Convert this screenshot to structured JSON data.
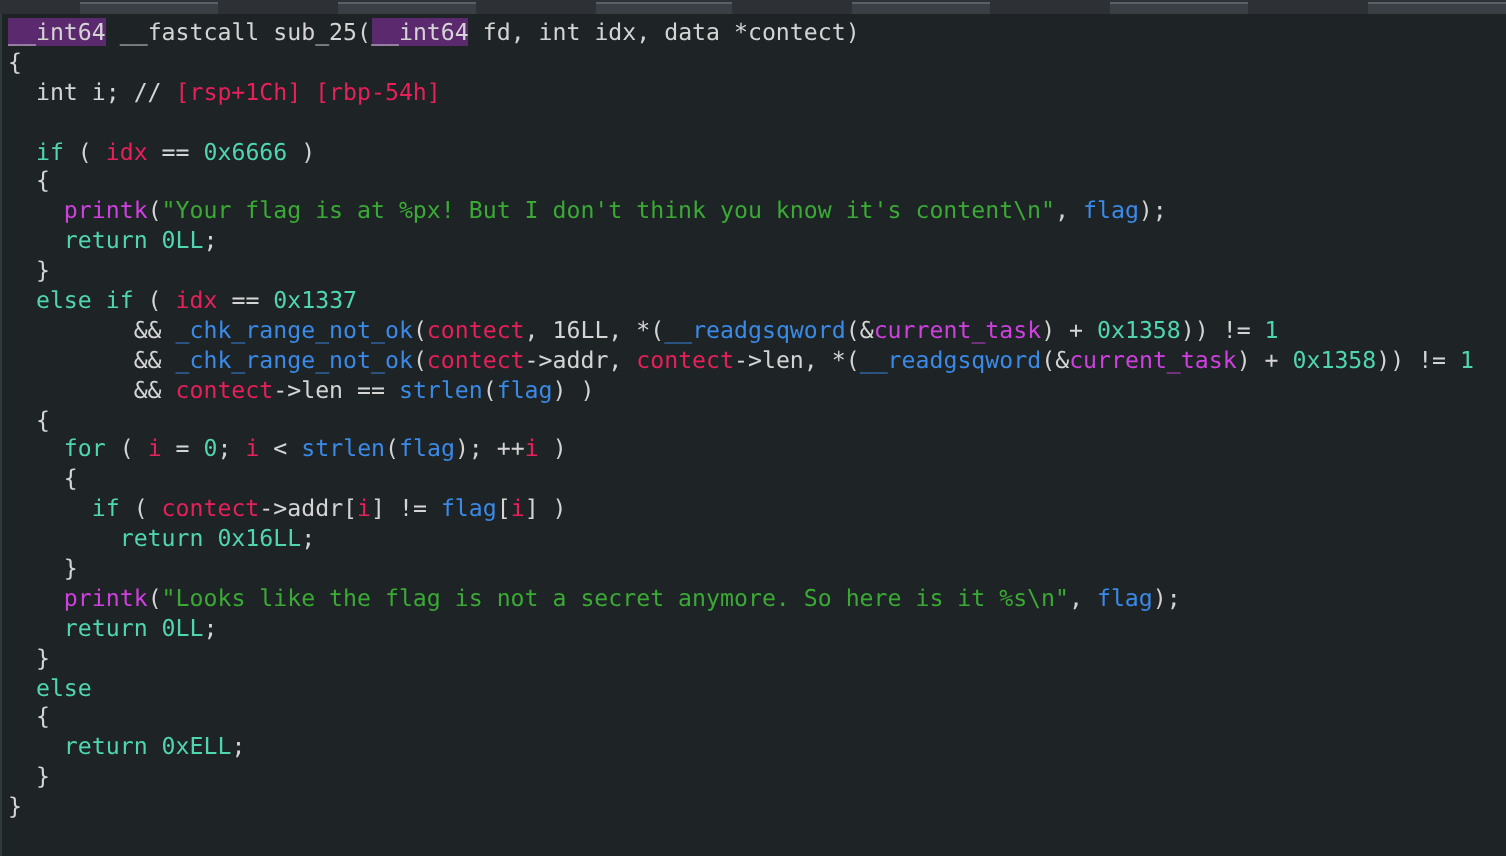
{
  "code_lines": [
    {
      "kind": "code",
      "tokens": [
        {
          "kind": "type",
          "text": "__int64"
        },
        {
          "kind": "plain",
          "text": " __fastcall sub_25("
        },
        {
          "kind": "type",
          "text": "__int64"
        },
        {
          "kind": "plain",
          "text": " fd, int idx, data *contect)"
        }
      ]
    },
    {
      "kind": "code",
      "tokens": [
        {
          "kind": "plain",
          "text": "{"
        }
      ]
    },
    {
      "kind": "code",
      "tokens": [
        {
          "kind": "plain",
          "text": "  int i; // "
        },
        {
          "kind": "address",
          "text": "[rsp+1Ch] [rbp-54h]"
        }
      ]
    },
    {
      "kind": "blank"
    },
    {
      "kind": "code",
      "tokens": [
        {
          "kind": "keyword",
          "text": "  if"
        },
        {
          "kind": "plain",
          "text": " ( "
        },
        {
          "kind": "var",
          "text": "idx"
        },
        {
          "kind": "plain",
          "text": " == "
        },
        {
          "kind": "number",
          "text": "0x6666"
        },
        {
          "kind": "plain",
          "text": " )"
        }
      ]
    },
    {
      "kind": "code",
      "tokens": [
        {
          "kind": "plain",
          "text": "  {"
        }
      ]
    },
    {
      "kind": "code",
      "tokens": [
        {
          "kind": "func",
          "text": "    printk"
        },
        {
          "kind": "plain",
          "text": "("
        },
        {
          "kind": "string",
          "text": "\"Your flag is at %px! But I don't think you know it's content\\n\""
        },
        {
          "kind": "plain",
          "text": ", "
        },
        {
          "kind": "call",
          "text": "flag"
        },
        {
          "kind": "plain",
          "text": ");"
        }
      ]
    },
    {
      "kind": "code",
      "tokens": [
        {
          "kind": "keyword",
          "text": "    return "
        },
        {
          "kind": "number",
          "text": "0LL"
        },
        {
          "kind": "plain",
          "text": ";"
        }
      ]
    },
    {
      "kind": "code",
      "tokens": [
        {
          "kind": "plain",
          "text": "  }"
        }
      ]
    },
    {
      "kind": "code",
      "tokens": [
        {
          "kind": "keyword",
          "text": "  else if"
        },
        {
          "kind": "plain",
          "text": " ( "
        },
        {
          "kind": "var",
          "text": "idx"
        },
        {
          "kind": "plain",
          "text": " == "
        },
        {
          "kind": "number",
          "text": "0x1337"
        }
      ]
    },
    {
      "kind": "code",
      "tokens": [
        {
          "kind": "plain",
          "text": "         && "
        },
        {
          "kind": "call",
          "text": "_chk_range_not_ok"
        },
        {
          "kind": "plain",
          "text": "("
        },
        {
          "kind": "var",
          "text": "contect"
        },
        {
          "kind": "plain",
          "text": ", 16LL, *("
        },
        {
          "kind": "call",
          "text": "__readgsqword"
        },
        {
          "kind": "plain",
          "text": "(&"
        },
        {
          "kind": "func",
          "text": "current_task"
        },
        {
          "kind": "plain",
          "text": ") + "
        },
        {
          "kind": "number",
          "text": "0x1358"
        },
        {
          "kind": "plain",
          "text": ")) != "
        },
        {
          "kind": "number",
          "text": "1"
        }
      ]
    },
    {
      "kind": "code",
      "tokens": [
        {
          "kind": "plain",
          "text": "         && "
        },
        {
          "kind": "call",
          "text": "_chk_range_not_ok"
        },
        {
          "kind": "plain",
          "text": "("
        },
        {
          "kind": "var",
          "text": "contect"
        },
        {
          "kind": "plain",
          "text": "->addr, "
        },
        {
          "kind": "var",
          "text": "contect"
        },
        {
          "kind": "plain",
          "text": "->len, *("
        },
        {
          "kind": "call",
          "text": "__readgsqword"
        },
        {
          "kind": "plain",
          "text": "(&"
        },
        {
          "kind": "func",
          "text": "current_task"
        },
        {
          "kind": "plain",
          "text": ") + "
        },
        {
          "kind": "number",
          "text": "0x1358"
        },
        {
          "kind": "plain",
          "text": ")) != "
        },
        {
          "kind": "number",
          "text": "1"
        }
      ]
    },
    {
      "kind": "code",
      "tokens": [
        {
          "kind": "plain",
          "text": "         && "
        },
        {
          "kind": "var",
          "text": "contect"
        },
        {
          "kind": "plain",
          "text": "->len == "
        },
        {
          "kind": "call",
          "text": "strlen"
        },
        {
          "kind": "plain",
          "text": "("
        },
        {
          "kind": "call",
          "text": "flag"
        },
        {
          "kind": "plain",
          "text": ") )"
        }
      ]
    },
    {
      "kind": "code",
      "tokens": [
        {
          "kind": "plain",
          "text": "  {"
        }
      ]
    },
    {
      "kind": "code",
      "tokens": [
        {
          "kind": "keyword",
          "text": "    for"
        },
        {
          "kind": "plain",
          "text": " ( "
        },
        {
          "kind": "var",
          "text": "i"
        },
        {
          "kind": "plain",
          "text": " = "
        },
        {
          "kind": "number",
          "text": "0"
        },
        {
          "kind": "plain",
          "text": "; "
        },
        {
          "kind": "var",
          "text": "i"
        },
        {
          "kind": "plain",
          "text": " < "
        },
        {
          "kind": "call",
          "text": "strlen"
        },
        {
          "kind": "plain",
          "text": "("
        },
        {
          "kind": "call",
          "text": "flag"
        },
        {
          "kind": "plain",
          "text": "); ++"
        },
        {
          "kind": "var",
          "text": "i"
        },
        {
          "kind": "plain",
          "text": " )"
        }
      ]
    },
    {
      "kind": "code",
      "tokens": [
        {
          "kind": "plain",
          "text": "    {"
        }
      ]
    },
    {
      "kind": "code",
      "tokens": [
        {
          "kind": "keyword",
          "text": "      if"
        },
        {
          "kind": "plain",
          "text": " ( "
        },
        {
          "kind": "var",
          "text": "contect"
        },
        {
          "kind": "plain",
          "text": "->addr["
        },
        {
          "kind": "var",
          "text": "i"
        },
        {
          "kind": "plain",
          "text": "] != "
        },
        {
          "kind": "call",
          "text": "flag"
        },
        {
          "kind": "plain",
          "text": "["
        },
        {
          "kind": "var",
          "text": "i"
        },
        {
          "kind": "plain",
          "text": "] )"
        }
      ]
    },
    {
      "kind": "code",
      "tokens": [
        {
          "kind": "keyword",
          "text": "        return "
        },
        {
          "kind": "number",
          "text": "0x16LL"
        },
        {
          "kind": "plain",
          "text": ";"
        }
      ]
    },
    {
      "kind": "code",
      "tokens": [
        {
          "kind": "plain",
          "text": "    }"
        }
      ]
    },
    {
      "kind": "code",
      "tokens": [
        {
          "kind": "func",
          "text": "    printk"
        },
        {
          "kind": "plain",
          "text": "("
        },
        {
          "kind": "string",
          "text": "\"Looks like the flag is not a secret anymore. So here is it %s\\n\""
        },
        {
          "kind": "plain",
          "text": ", "
        },
        {
          "kind": "call",
          "text": "flag"
        },
        {
          "kind": "plain",
          "text": ");"
        }
      ]
    },
    {
      "kind": "code",
      "tokens": [
        {
          "kind": "keyword",
          "text": "    return "
        },
        {
          "kind": "number",
          "text": "0LL"
        },
        {
          "kind": "plain",
          "text": ";"
        }
      ]
    },
    {
      "kind": "code",
      "tokens": [
        {
          "kind": "plain",
          "text": "  }"
        }
      ]
    },
    {
      "kind": "code",
      "tokens": [
        {
          "kind": "keyword",
          "text": "  else"
        }
      ]
    },
    {
      "kind": "code",
      "tokens": [
        {
          "kind": "plain",
          "text": "  {"
        }
      ]
    },
    {
      "kind": "code",
      "tokens": [
        {
          "kind": "keyword",
          "text": "    return "
        },
        {
          "kind": "number",
          "text": "0xELL"
        },
        {
          "kind": "plain",
          "text": ";"
        }
      ]
    },
    {
      "kind": "code",
      "tokens": [
        {
          "kind": "plain",
          "text": "  }"
        }
      ]
    },
    {
      "kind": "code",
      "tokens": [
        {
          "kind": "plain",
          "text": "}"
        }
      ]
    }
  ]
}
